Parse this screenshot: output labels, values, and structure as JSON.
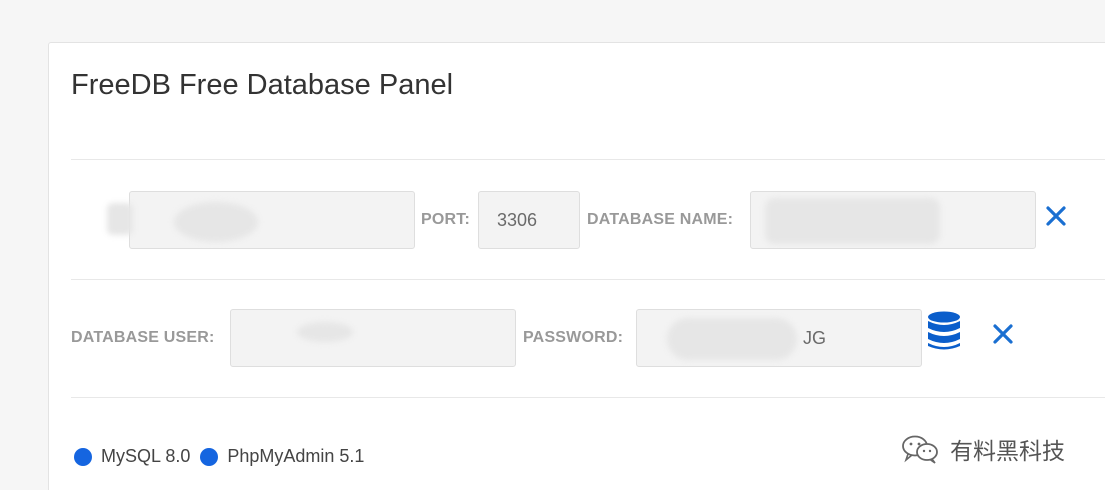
{
  "panel": {
    "title": "FreeDB Free Database Panel"
  },
  "row1": {
    "host_value": "",
    "port_label": "PORT:",
    "port_value": "3306",
    "dbname_label": "DATABASE NAME:",
    "dbname_value": ""
  },
  "row2": {
    "user_label": "DATABASE USER:",
    "user_value": "",
    "password_label": "PASSWORD:",
    "password_value": "JG"
  },
  "legend": {
    "items": [
      {
        "label": "MySQL 8.0",
        "color": "#1565e0"
      },
      {
        "label": "PhpMyAdmin 5.1",
        "color": "#1565e0"
      }
    ]
  },
  "watermark": {
    "text": "有料黑科技",
    "icon": "wechat-icon"
  },
  "colors": {
    "accent": "#1a6fd1",
    "icon_blue": "#0b5ecb"
  }
}
